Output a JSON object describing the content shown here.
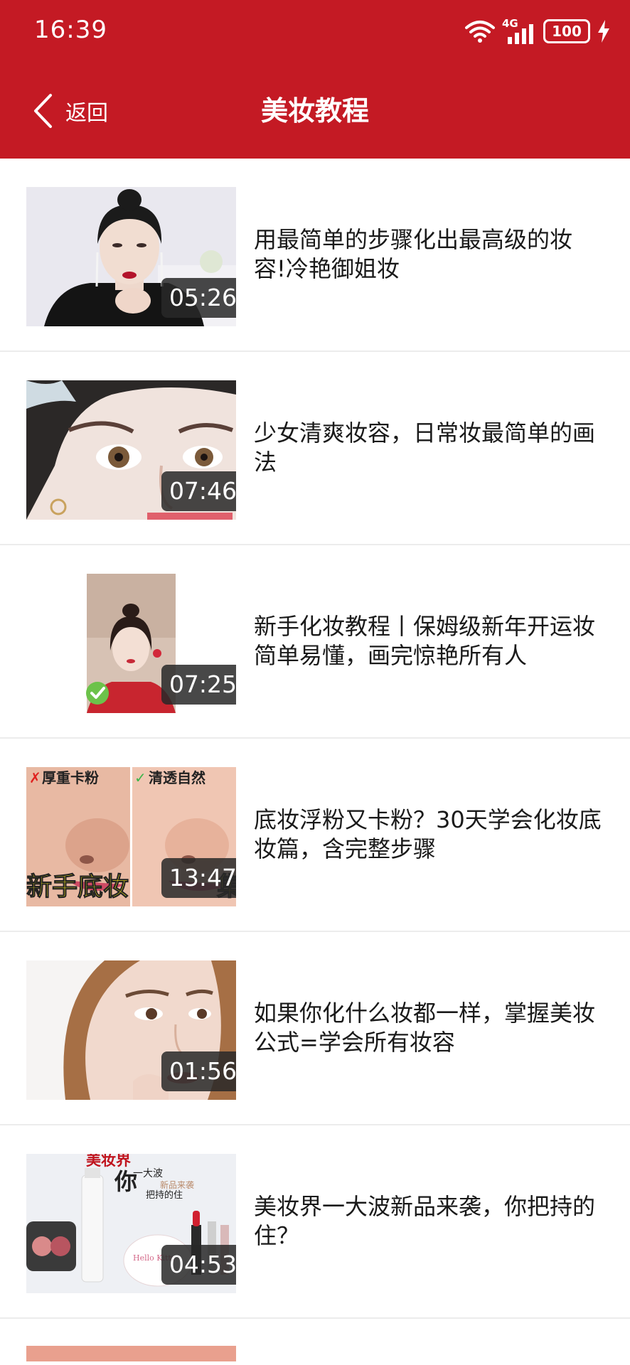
{
  "status_bar": {
    "time": "16:39",
    "network": "4G",
    "battery": "100"
  },
  "nav": {
    "back_label": "返回",
    "title": "美妆教程"
  },
  "videos": [
    {
      "title": "用最简单的步骤化出最高级的妆容!冷艳御姐妆",
      "duration": "05:26"
    },
    {
      "title": "少女清爽妆容，日常妆最简单的画法",
      "duration": "07:46"
    },
    {
      "title": "新手化妆教程丨保姆级新年开运妆简单易懂，画完惊艳所有人",
      "duration": "07:25"
    },
    {
      "title": "底妆浮粉又卡粉？30天学会化妆底妆篇，含完整步骤",
      "duration": "13:47"
    },
    {
      "title": "如果你化什么妆都一样，掌握美妆公式=学会所有妆容",
      "duration": "01:56"
    },
    {
      "title": "美妆界一大波新品来袭，你把持的住？",
      "duration": "04:53"
    }
  ],
  "thumb_text": {
    "v4_left_label": "厚重卡粉",
    "v4_right_label": "清透自然",
    "v4_banner": "新手底妆",
    "v4_banner_right": "集",
    "v6_title_line1": "美妆界",
    "v6_title_big": "你",
    "v6_title_line2": "一大波",
    "v6_title_line3": "新品来袭",
    "v6_title_line4": "把持的住",
    "v6_brand": "Hello Kitty"
  },
  "colors": {
    "header_bg": "#c41a24",
    "header_text": "#ffffff",
    "title_text": "#1a1a1a",
    "divider": "#ececec"
  }
}
